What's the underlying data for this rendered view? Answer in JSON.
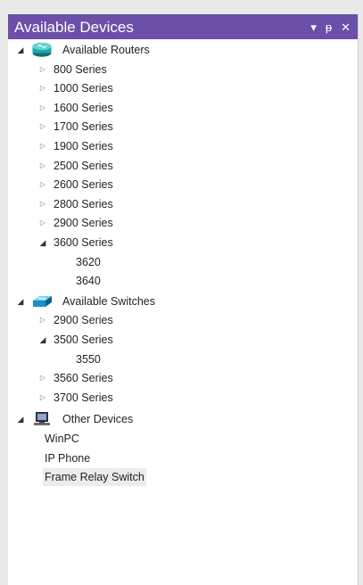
{
  "panel": {
    "title": "Available Devices",
    "buttons": {
      "menu": "▾",
      "pin": "ᵽ",
      "close": "✕"
    }
  },
  "colors": {
    "titlebar": "#6b4fa8",
    "router": "#1aa7a7",
    "switch": "#1b8fc6",
    "selected": "#ececec"
  },
  "tree": {
    "routers": {
      "label": "Available Routers",
      "icon": "router-icon",
      "items": [
        {
          "label": "800 Series",
          "expanded": false
        },
        {
          "label": "1000 Series",
          "expanded": false
        },
        {
          "label": "1600 Series",
          "expanded": false
        },
        {
          "label": "1700 Series",
          "expanded": false
        },
        {
          "label": "1900 Series",
          "expanded": false
        },
        {
          "label": "2500 Series",
          "expanded": false
        },
        {
          "label": "2600 Series",
          "expanded": false
        },
        {
          "label": "2800 Series",
          "expanded": false
        },
        {
          "label": "2900 Series",
          "expanded": false
        },
        {
          "label": "3600 Series",
          "expanded": true,
          "children": [
            "3620",
            "3640"
          ]
        }
      ]
    },
    "switches": {
      "label": "Available Switches",
      "icon": "switch-icon",
      "items": [
        {
          "label": "2900 Series",
          "expanded": false
        },
        {
          "label": "3500 Series",
          "expanded": true,
          "children": [
            "3550"
          ]
        },
        {
          "label": "3560 Series",
          "expanded": false
        },
        {
          "label": "3700 Series",
          "expanded": false
        }
      ]
    },
    "other": {
      "label": "Other Devices",
      "icon": "computer-icon",
      "items": [
        "WinPC",
        "IP Phone",
        "Frame Relay Switch"
      ],
      "selected": "Frame Relay Switch"
    }
  }
}
